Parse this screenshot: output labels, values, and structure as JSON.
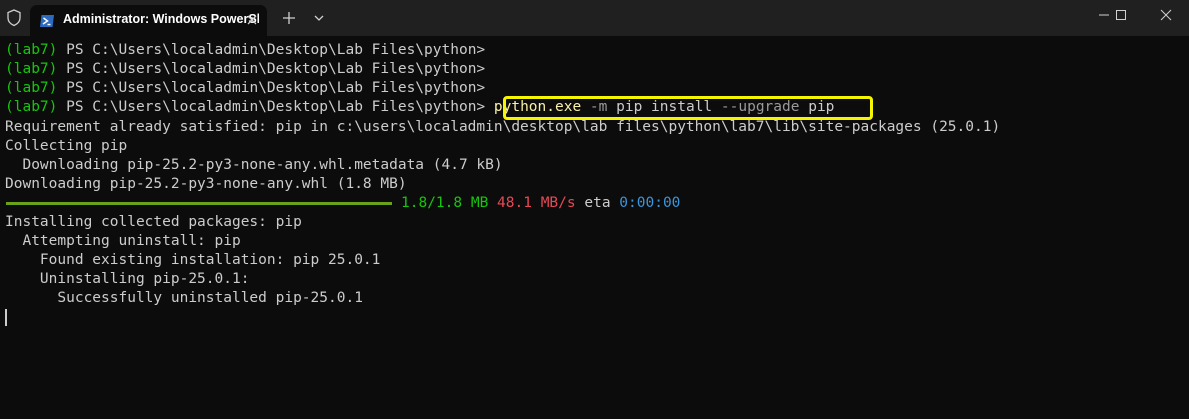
{
  "window": {
    "tab_title": "Administrator: Windows PowerShell"
  },
  "terminal": {
    "prompt_venv": "(lab7)",
    "prompt_path": " PS C:\\Users\\localadmin\\Desktop\\Lab Files\\python>",
    "command": {
      "exe": "python.exe",
      "flag1": " -m",
      "args1": " pip install",
      "flag2": " --upgrade",
      "args2": " pip"
    },
    "output": [
      "Requirement already satisfied: pip in c:\\users\\localadmin\\desktop\\lab files\\python\\lab7\\lib\\site-packages (25.0.1)",
      "Collecting pip",
      "  Downloading pip-25.2-py3-none-any.whl.metadata (4.7 kB)",
      "Downloading pip-25.2-py3-none-any.whl (1.8 MB)"
    ],
    "progress": {
      "fraction": 1.0,
      "size": "1.8/1.8 MB",
      "speed": "48.1 MB/s",
      "eta_label": "eta",
      "eta": "0:00:00"
    },
    "install_output": [
      "Installing collected packages: pip",
      "  Attempting uninstall: pip",
      "    Found existing installation: pip 25.0.1",
      "    Uninstalling pip-25.0.1:",
      "      Successfully uninstalled pip-25.0.1"
    ]
  },
  "colors": {
    "background": "#0c0c0c",
    "titlebar": "#202020",
    "venv_green": "#16c60c",
    "highlight_yellow": "#f5f500",
    "speed_red": "#e74856",
    "eta_cyan": "#3a96dd"
  },
  "icons": [
    "shield-icon",
    "powershell-icon",
    "close-icon",
    "plus-icon",
    "chevron-down-icon",
    "minimize-icon",
    "maximize-icon",
    "close-window-icon"
  ]
}
